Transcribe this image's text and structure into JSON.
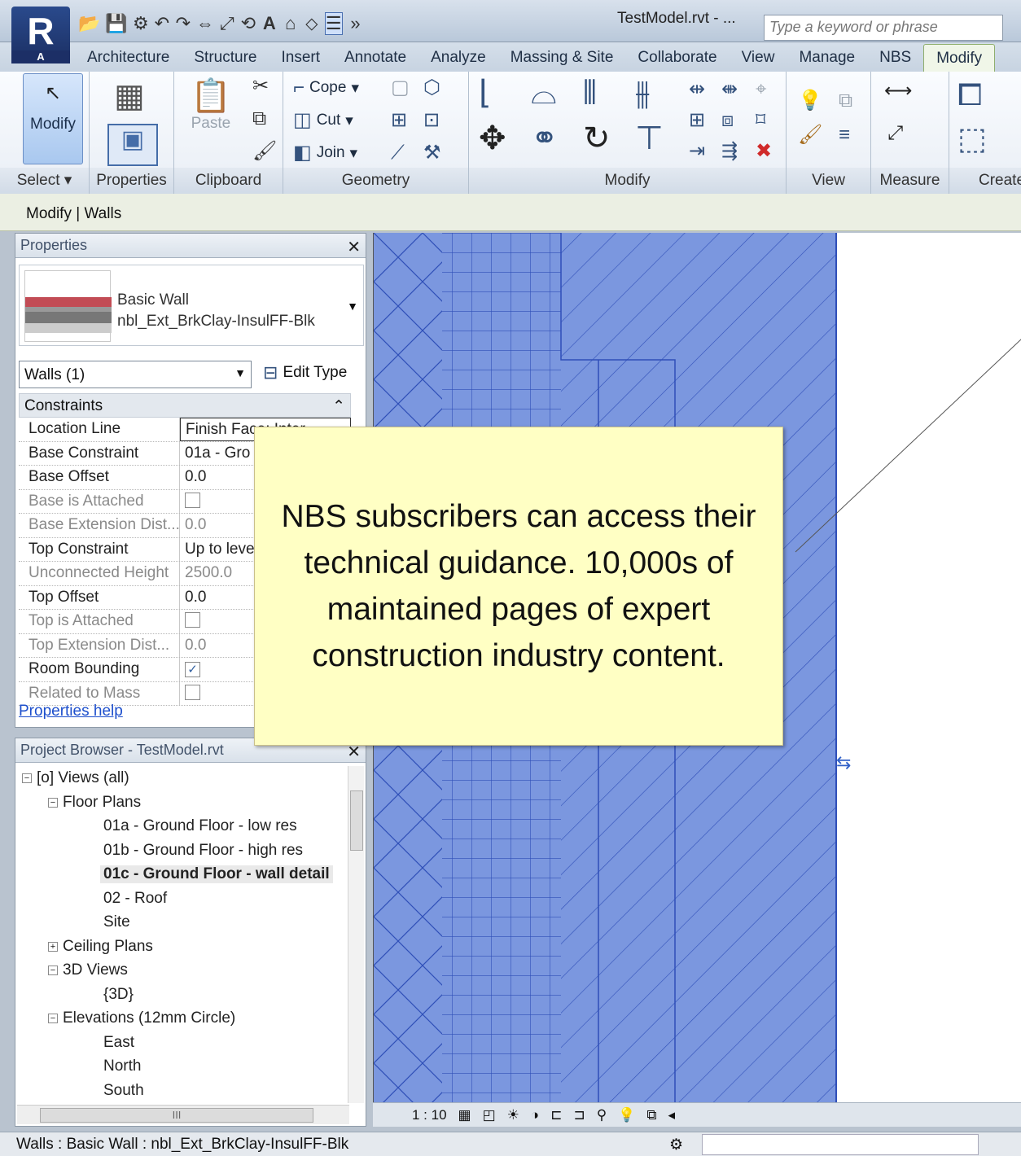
{
  "app": {
    "logo_letter": "R",
    "logo_sub": "A",
    "document_title": "TestModel.rvt - ...",
    "search_placeholder": "Type a keyword or phrase"
  },
  "tabs": [
    "Architecture",
    "Structure",
    "Insert",
    "Annotate",
    "Analyze",
    "Massing & Site",
    "Collaborate",
    "View",
    "Manage",
    "NBS",
    "Modify"
  ],
  "ribbon": {
    "modify_label": "Modify",
    "select_label": "Select ▾",
    "properties_label": "Properties",
    "clipboard_label": "Clipboard",
    "paste_label": "Paste",
    "geometry_label": "Geometry",
    "cope_label": "Cope",
    "cut_label": "Cut",
    "join_label": "Join",
    "modify_panel_label": "Modify",
    "view_label": "View",
    "measure_label": "Measure",
    "create_label": "Create"
  },
  "context": {
    "title": "Modify | Walls"
  },
  "properties": {
    "title": "Properties",
    "type_family": "Basic Wall",
    "type_name": "nbl_Ext_BrkClay-InsulFF-Blk",
    "instance_selector": "Walls (1)",
    "edit_type": "Edit Type",
    "group": "Constraints",
    "rows": [
      {
        "k": "Location Line",
        "v": "Finish Face: Inter"
      },
      {
        "k": "Base Constraint",
        "v": "01a - Gro"
      },
      {
        "k": "Base Offset",
        "v": "0.0"
      },
      {
        "k": "Base is Attached",
        "v": ""
      },
      {
        "k": "Base Extension Dist...",
        "v": "0.0"
      },
      {
        "k": "Top Constraint",
        "v": "Up to leve"
      },
      {
        "k": "Unconnected Height",
        "v": "2500.0"
      },
      {
        "k": "Top Offset",
        "v": "0.0"
      },
      {
        "k": "Top is Attached",
        "v": ""
      },
      {
        "k": "Top Extension Dist...",
        "v": "0.0"
      },
      {
        "k": "Room Bounding",
        "v": ""
      },
      {
        "k": "Related to Mass",
        "v": ""
      }
    ],
    "help_link": "Properties help"
  },
  "browser": {
    "title": "Project Browser - TestModel.rvt",
    "views": "Views (all)",
    "floor_plans": "Floor Plans",
    "fp1": "01a - Ground Floor - low res",
    "fp2": "01b - Ground Floor - high res",
    "fp3": "01c - Ground Floor - wall detail",
    "fp4": "02 - Roof",
    "fp5": "Site",
    "ceiling": "Ceiling Plans",
    "views3d": "3D Views",
    "view3d": "{3D}",
    "elevations": "Elevations (12mm Circle)",
    "east": "East",
    "north": "North",
    "south": "South",
    "scroll_thumb": "III"
  },
  "callout": {
    "text": "NBS subscribers can access their technical guidance. 10,000s of maintained pages of expert construction industry content."
  },
  "viewbar": {
    "scale": "1 : 10"
  },
  "status": {
    "text": "Walls : Basic Wall : nbl_Ext_BrkClay-InsulFF-Blk"
  },
  "colors": {
    "wall_fill": "#7b97df",
    "wall_line": "#2f4fb8",
    "callout_bg": "#ffffc4"
  }
}
